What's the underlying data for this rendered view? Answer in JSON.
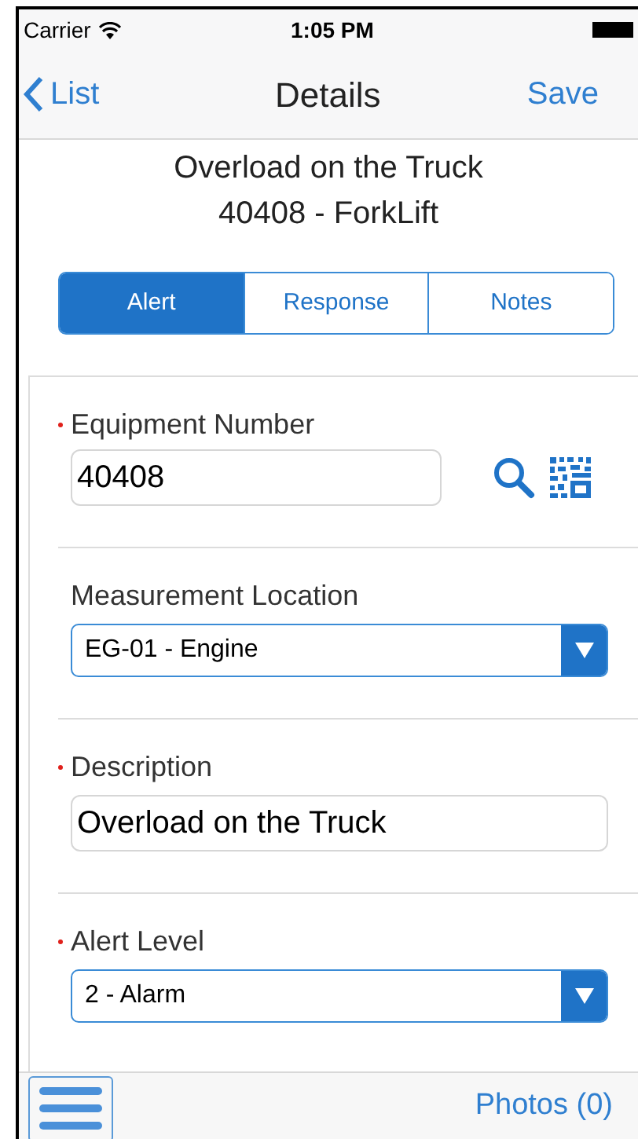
{
  "status_bar": {
    "carrier": "Carrier",
    "time": "1:05 PM"
  },
  "nav_bar": {
    "back": "List",
    "title": "Details",
    "action": "Save"
  },
  "header": {
    "title": "Overload on the Truck",
    "subtitle": "40408 - ForkLift"
  },
  "tabs": [
    {
      "label": "Alert",
      "selected": true
    },
    {
      "label": "Response",
      "selected": false
    },
    {
      "label": "Notes",
      "selected": false
    }
  ],
  "fields": [
    {
      "kind": "lookup",
      "label": "Equipment Number",
      "required": true,
      "value": "40408"
    },
    {
      "kind": "select",
      "label": "Measurement Location",
      "required": false,
      "value": "EG-01 - Engine"
    },
    {
      "kind": "text",
      "label": "Description",
      "required": true,
      "value": "Overload on the Truck"
    },
    {
      "kind": "select",
      "label": "Alert Level",
      "required": true,
      "value": "2 - Alarm"
    }
  ],
  "toolbar": {
    "photos": "Photos (0)"
  }
}
